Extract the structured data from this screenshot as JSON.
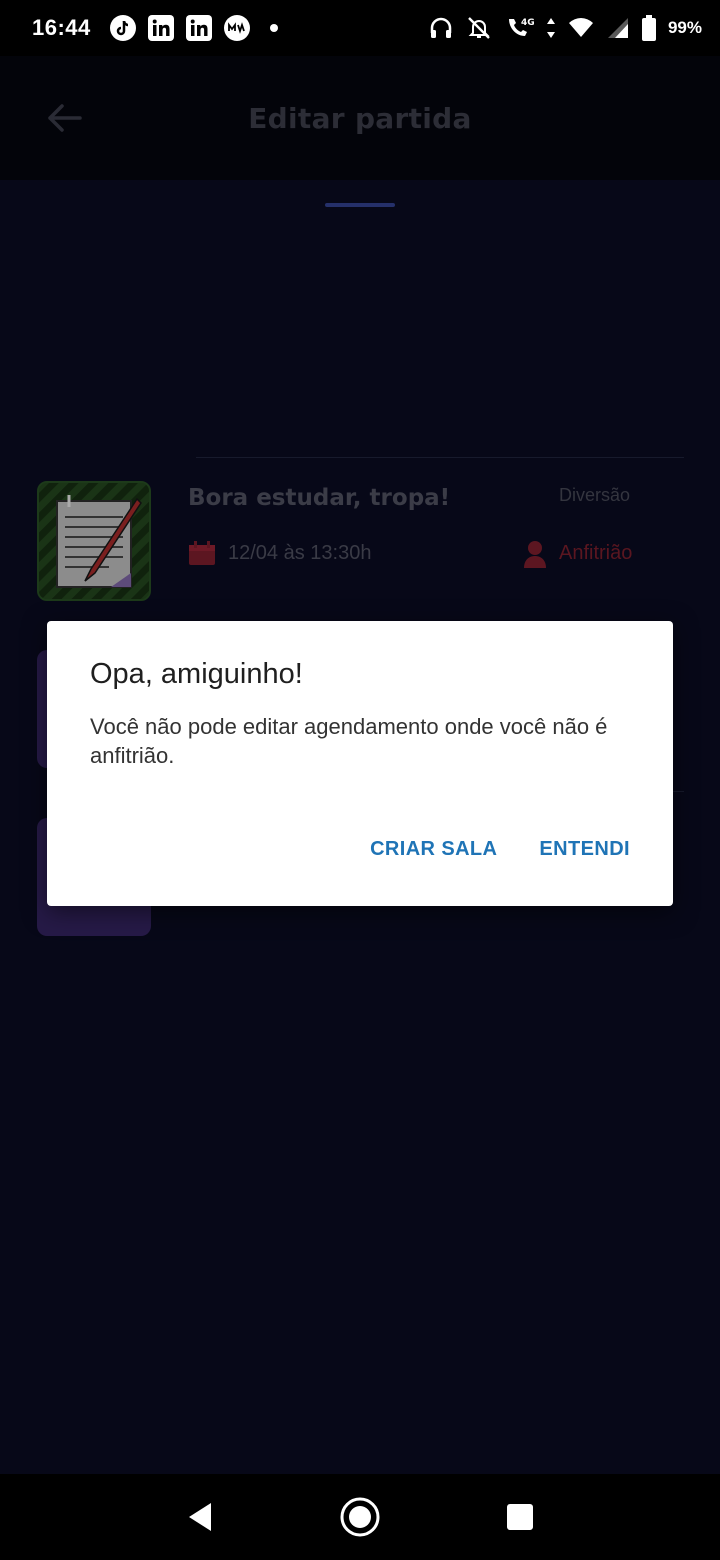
{
  "status_bar": {
    "time": "16:44",
    "battery": "99%",
    "network": "4G",
    "left_icons": [
      "tiktok-icon",
      "linkedin-icon",
      "linkedin-icon",
      "me-icon",
      "dot-icon"
    ],
    "right_icons": [
      "headphones-icon",
      "bell-off-icon",
      "wifi-call-icon",
      "wifi-icon",
      "signal-icon",
      "battery-icon"
    ]
  },
  "header": {
    "title": "Editar partida",
    "back_icon": "arrow-left-icon"
  },
  "match": {
    "title": "Bora estudar, tropa!",
    "category": "Diversão",
    "date": "12/04 às 13:30h",
    "role": "Anfitrião",
    "thumb_icon": "notebook-pencil-icon"
  },
  "dialog": {
    "title": "Opa, amiguinho!",
    "message": "Você não pode editar agendamento onde você não é anfitrião.",
    "primary_button": "ENTENDI",
    "secondary_button": "CRIAR SALA"
  },
  "colors": {
    "background": "#070818",
    "dialog_button": "#1f74b6",
    "host_accent": "#5a1620",
    "side_card": "#261a47"
  },
  "nav_bar": {
    "icons": [
      "back-triangle-icon",
      "home-circle-icon",
      "recents-square-icon"
    ]
  }
}
